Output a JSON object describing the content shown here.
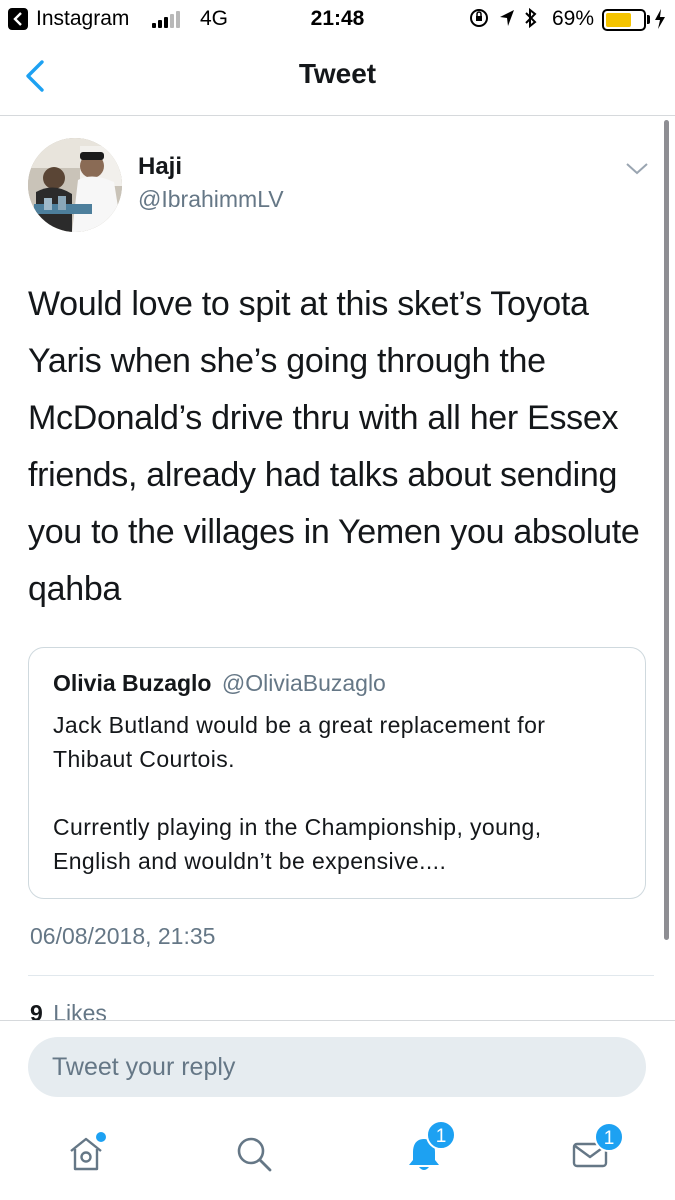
{
  "status_bar": {
    "back_app": "Instagram",
    "network": "4G",
    "time": "21:48",
    "battery": "69%",
    "battery_level": 0.69,
    "battery_color": "#f5c400"
  },
  "nav": {
    "title": "Tweet",
    "back_icon": "chevron-left-icon"
  },
  "tweet": {
    "author_name": "Haji",
    "author_handle": "@IbrahimmLV",
    "text": "Would love to spit at this sket’s Toyota Yaris when she’s going through the McDonald’s drive thru with all her Essex friends, already had talks about sending you to the villages in Yemen you absolute qahba",
    "timestamp": "06/08/2018, 21:35",
    "likes_count": "9",
    "likes_label": "Likes"
  },
  "quoted_tweet": {
    "author_name": "Olivia Buzaglo",
    "author_handle": "@OliviaBuzaglo",
    "text": "Jack Butland would be a great replacement for Thibaut Courtois.\n\nCurrently playing in the Championship, young, English and wouldn’t be expensive...."
  },
  "reply": {
    "placeholder": "Tweet your reply"
  },
  "tab_bar": {
    "tabs": [
      {
        "icon": "home-icon",
        "badge": ""
      },
      {
        "icon": "search-icon",
        "badge": ""
      },
      {
        "icon": "notifications-bell-icon",
        "badge": "1"
      },
      {
        "icon": "messages-envelope-icon",
        "badge": "1"
      }
    ]
  },
  "colors": {
    "accent": "#1da1f2",
    "text_primary": "#14171a",
    "text_secondary": "#657786"
  }
}
